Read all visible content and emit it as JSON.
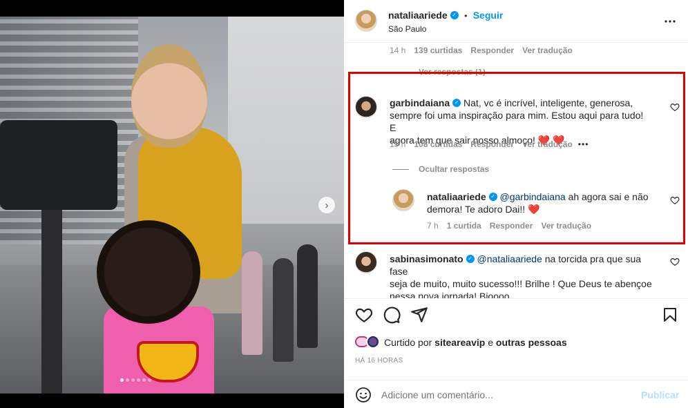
{
  "post": {
    "author": "nataliaariede",
    "separator": "•",
    "follow_label": "Seguir",
    "location": "São Paulo",
    "more_icon": "more-horizontal-icon"
  },
  "prev_comment_meta": {
    "time": "14 h",
    "likes": "139 curtidas",
    "reply": "Responder",
    "translate": "Ver tradução"
  },
  "hidden_reply_text": "Ver respostas (1)",
  "comments": [
    {
      "user": "garbindaiana",
      "verified": true,
      "text_lines": [
        "Nat, vc é incrível, inteligente, generosa,",
        "sempre foi uma inspiração para mim. Estou aqui para tudo! E",
        "agora tem que sair nosso almoço!"
      ],
      "hearts": "❤️ ❤️",
      "time": "15 h",
      "likes": "108 curtidas",
      "reply": "Responder",
      "translate": "Ver tradução",
      "more": "•••"
    },
    {
      "user": "sabinasimonato",
      "verified": true,
      "mention": "@nataliaariede",
      "text_first": " na torcida pra que sua fase",
      "text_lines": [
        "seja de muito, muito sucesso!!! Brilhe ! Que Deus te abençoe",
        "nessa nova jornada! Bjoooo"
      ]
    }
  ],
  "hide_replies_label": "Ocultar respostas",
  "reply": {
    "user": "nataliaariede",
    "verified": true,
    "mention": "@garbindaiana",
    "text_first": " ah agora sai e não",
    "text_second": "demora! Te adoro Dai!!",
    "heart": "❤️",
    "time": "7 h",
    "likes": "1 curtida",
    "reply": "Responder",
    "translate": "Ver tradução"
  },
  "likes_summary": {
    "prefix": "Curtido por",
    "user": "siteareavip",
    "conj": "e",
    "others": "outras pessoas"
  },
  "timestamp": "HÁ 16 HORAS",
  "add_comment": {
    "placeholder": "Adicione um comentário...",
    "publish_label": "Publicar"
  },
  "colors": {
    "accent": "#0095f6",
    "highlight_box": "#e00000",
    "meta_text": "#8e8e8e"
  },
  "photo": {
    "slide_count": 6,
    "active_slide": 1
  }
}
